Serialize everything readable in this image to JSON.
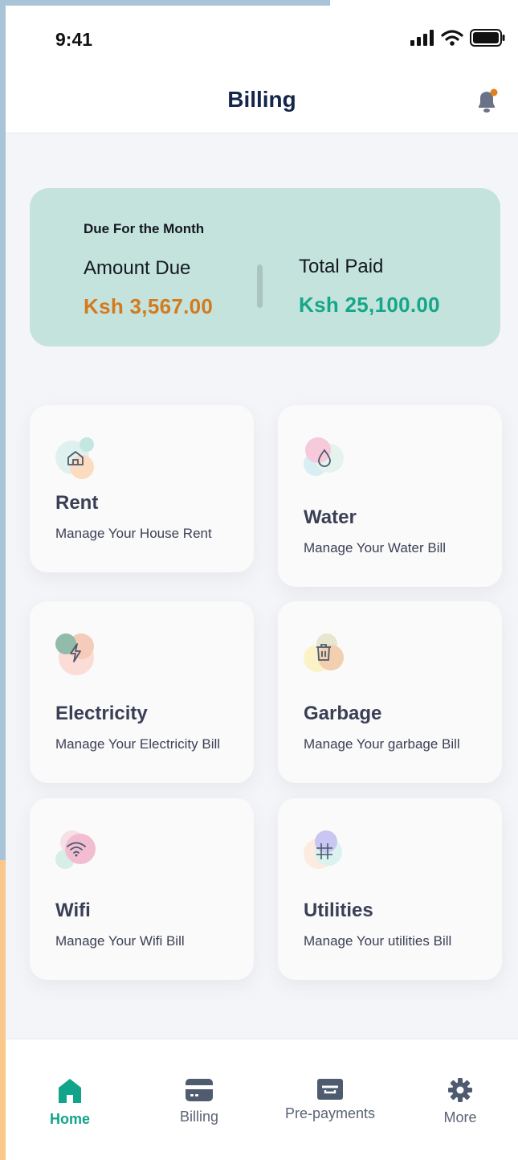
{
  "status_bar": {
    "time": "9:41"
  },
  "header": {
    "title": "Billing"
  },
  "summary": {
    "heading": "Due For the Month",
    "amount_due_label": "Amount Due",
    "amount_due_value": "Ksh 3,567.00",
    "total_paid_label": "Total Paid",
    "total_paid_value": "Ksh 25,100.00"
  },
  "cards": [
    {
      "title": "Rent",
      "subtitle": "Manage Your House Rent",
      "icon": "house-icon"
    },
    {
      "title": "Water",
      "subtitle": "Manage Your Water Bill",
      "icon": "water-drop-icon"
    },
    {
      "title": "Electricity",
      "subtitle": "Manage Your Electricity Bill",
      "icon": "lightning-icon"
    },
    {
      "title": "Garbage",
      "subtitle": "Manage Your garbage Bill",
      "icon": "trash-icon"
    },
    {
      "title": "Wifi",
      "subtitle": "Manage Your Wifi Bill",
      "icon": "wifi-icon"
    },
    {
      "title": "Utilities",
      "subtitle": "Manage Your utilities Bill",
      "icon": "grid-icon"
    }
  ],
  "tab_bar": {
    "items": [
      {
        "label": "Home",
        "icon": "home-icon",
        "active": true
      },
      {
        "label": "Billing",
        "icon": "card-icon",
        "active": false
      },
      {
        "label": "Pre-payments",
        "icon": "wallet-icon",
        "active": false
      },
      {
        "label": "More",
        "icon": "gear-icon",
        "active": false
      }
    ]
  },
  "colors": {
    "accent_teal": "#11a48a",
    "amount_due": "#d47a1e",
    "total_paid": "#16a788",
    "summary_bg": "#c4e3dd",
    "title": "#14264b"
  }
}
